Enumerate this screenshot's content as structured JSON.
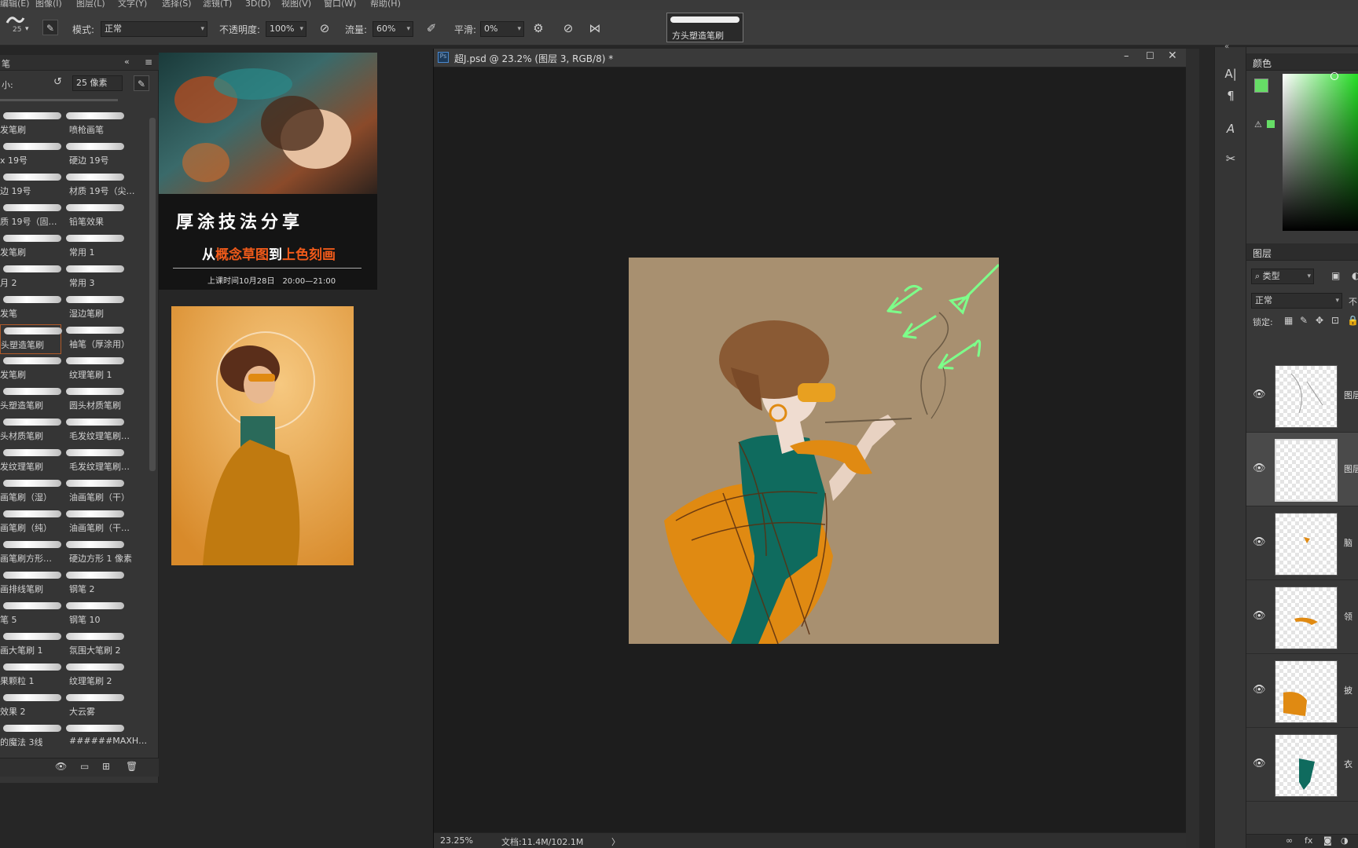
{
  "menubar": {
    "items": [
      "编辑(E)",
      "图像(I)",
      "图层(L)",
      "文字(Y)",
      "选择(S)",
      "滤镜(T)",
      "3D(D)",
      "视图(V)",
      "窗口(W)",
      "帮助(H)"
    ]
  },
  "options": {
    "brush_size": "25",
    "mode_label": "模式:",
    "mode_value": "正常",
    "opacity_label": "不透明度:",
    "opacity_value": "100%",
    "flow_label": "流量:",
    "flow_value": "60%",
    "smoothing_label": "平滑:",
    "smoothing_value": "0%",
    "preset_name": "方头塑造笔刷"
  },
  "brush_panel": {
    "header_label": "笔",
    "size_label": "小:",
    "size_value": "25 像素",
    "brushes_left": [
      "发笔刷",
      "x 19号",
      "边 19号",
      "质 19号（固…",
      "发笔刷",
      "月 2",
      "发笔",
      "头塑造笔刷",
      "发笔刷",
      "头塑造笔刷",
      "头材质笔刷",
      "发纹理笔刷",
      "画笔刷（湿）",
      "画笔刷（纯）",
      "画笔刷方形…",
      "画排线笔刷",
      "笔 5",
      "画大笔刷 1",
      "果颗粒 1",
      "效果 2",
      "的魔法 3线"
    ],
    "brushes_right": [
      "喷枪画笔",
      "硬边 19号",
      "材质 19号（尖…",
      "铅笔效果",
      "常用 1",
      "常用 3",
      "湿边笔刷",
      "袖笔（厚涂用）",
      "纹理笔刷 1",
      "圆头材质笔刷",
      "毛发纹理笔刷…",
      "毛发纹理笔刷…",
      "油画笔刷（干）",
      "油画笔刷（干…",
      "硬边方形 1 像素",
      "钢笔 2",
      "钢笔 10",
      "氛围大笔刷 2",
      "纹理笔刷 2",
      "大云雾",
      "######MAXH…"
    ]
  },
  "reference1": {
    "title": "厚涂技法分享",
    "subtitle_pre": "从",
    "subtitle_hl1": "概念草图",
    "subtitle_mid": "到",
    "subtitle_hl2": "上色刻画",
    "schedule": "上课时间10月28日　20:00—21:00"
  },
  "document": {
    "tab_title": "超J.psd @ 23.2% (图层 3, RGB/8) *",
    "zoom": "23.25%",
    "doc_info": "文档:11.4M/102.1M",
    "arrow": "〉"
  },
  "right_panel": {
    "color_tab": "颜色",
    "layers_tab": "图层",
    "filter_label": "类型",
    "blend_mode": "正常",
    "opacity_short": "不",
    "lock_label": "锁定:",
    "layers": [
      {
        "name": "图层"
      },
      {
        "name": "图层"
      },
      {
        "name": "脑"
      },
      {
        "name": "领"
      },
      {
        "name": "披"
      },
      {
        "name": "衣"
      }
    ]
  },
  "colors": {
    "foreground": "#66dd66",
    "background": "#cccccc",
    "canvas_bg": "#a89070",
    "accent_orange": "#e08a12",
    "teal": "#0f6b5e"
  }
}
